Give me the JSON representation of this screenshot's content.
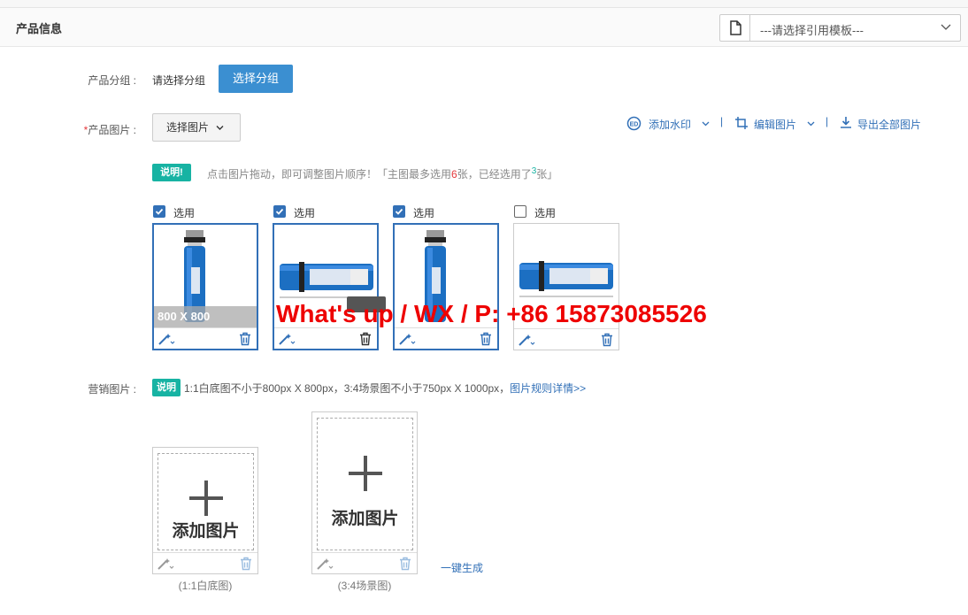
{
  "header": {
    "title": "产品信息",
    "template_placeholder": "---请选择引用模板---"
  },
  "group": {
    "label": "产品分组 :",
    "value": "请选择分组",
    "button": "选择分组"
  },
  "images": {
    "label": "产品图片 :",
    "required_mark": "*",
    "select_button": "选择图片",
    "tools": {
      "watermark": "添加水印",
      "edit": "编辑图片",
      "export": "导出全部图片"
    },
    "tip_badge": "说明!",
    "tip_text_1": "点击图片拖动，即可调整图片顺序！「主图最多选用",
    "tip_max": "6",
    "tip_text_2": "张，已经选用了",
    "tip_used": "3",
    "tip_text_3": "张」",
    "items": [
      {
        "check_label": "选用",
        "checked": true,
        "size_label": "800 X 800"
      },
      {
        "check_label": "选用",
        "checked": true,
        "size_label": ""
      },
      {
        "check_label": "选用",
        "checked": true,
        "size_label": ""
      },
      {
        "check_label": "选用",
        "checked": false,
        "size_label": ""
      }
    ]
  },
  "watermark_overlay": "What's up / WX / P: +86 15873085526",
  "marketing": {
    "label": "营销图片 :",
    "badge": "说明",
    "tip": "1:1白底图不小于800px X 800px，3:4场景图不小于750px X 1000px，",
    "link": "图片规则详情>>",
    "add_text": "添加图片",
    "caption_1": "(1:1白底图)",
    "caption_2": "(3:4场景图)",
    "generate": "一键生成"
  }
}
